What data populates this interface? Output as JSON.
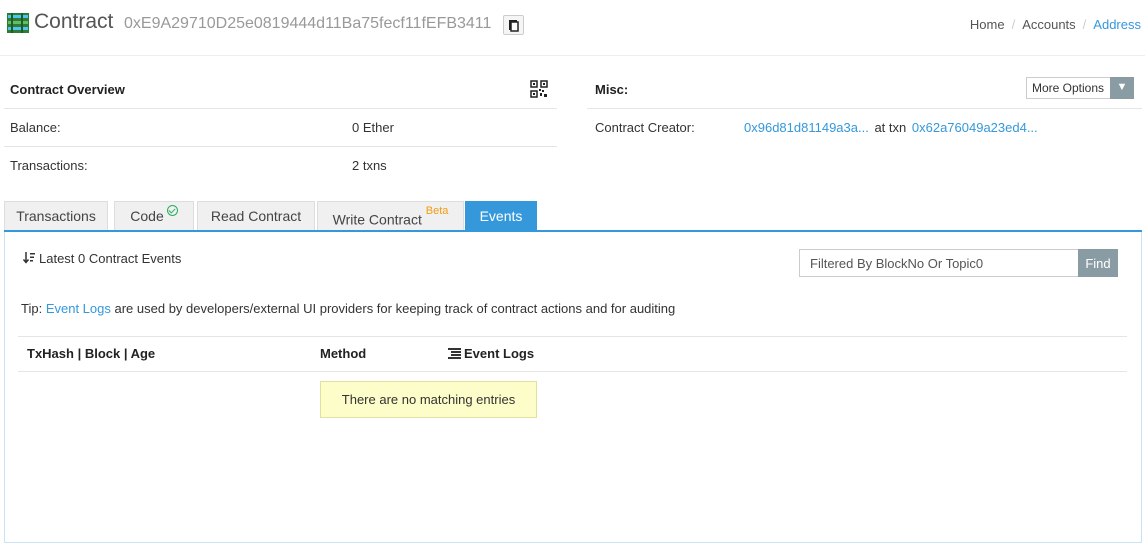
{
  "header": {
    "title": "Contract",
    "address": "0xE9A29710D25e0819444d11Ba75fecf11fEFB3411",
    "breadcrumb": [
      "Home",
      "Accounts",
      "Address"
    ]
  },
  "overview": {
    "title": "Contract Overview",
    "balance_label": "Balance:",
    "balance_value": "0 Ether",
    "transactions_label": "Transactions:",
    "transactions_value": "2 txns"
  },
  "misc": {
    "title": "Misc:",
    "more_options": "More Options",
    "creator_label": "Contract Creator:",
    "creator_address": "0x96d81d81149a3a...",
    "at_txn": "at txn",
    "creator_txn": "0x62a76049a23ed4..."
  },
  "tabs": [
    {
      "label": "Transactions",
      "active": false
    },
    {
      "label": "Code",
      "active": false
    },
    {
      "label": "Read Contract",
      "active": false
    },
    {
      "label": "Write Contract",
      "badge": "Beta",
      "active": false
    },
    {
      "label": "Events",
      "active": true
    }
  ],
  "events": {
    "heading": "Latest 0 Contract Events",
    "filter_placeholder": "Filtered By BlockNo Or Topic0",
    "find_label": "Find",
    "tip_prefix": "Tip:",
    "tip_link": "Event Logs",
    "tip_text": "are used by developers/external UI providers for keeping track of contract actions and for auditing",
    "columns": [
      "TxHash | Block | Age",
      "Method",
      "Event Logs"
    ],
    "empty_message": "There are no matching entries"
  },
  "colors": {
    "accent": "#3498db",
    "beta": "#f39c12",
    "verified": "#27ae60",
    "empty_bg": "#fdfdc9"
  }
}
